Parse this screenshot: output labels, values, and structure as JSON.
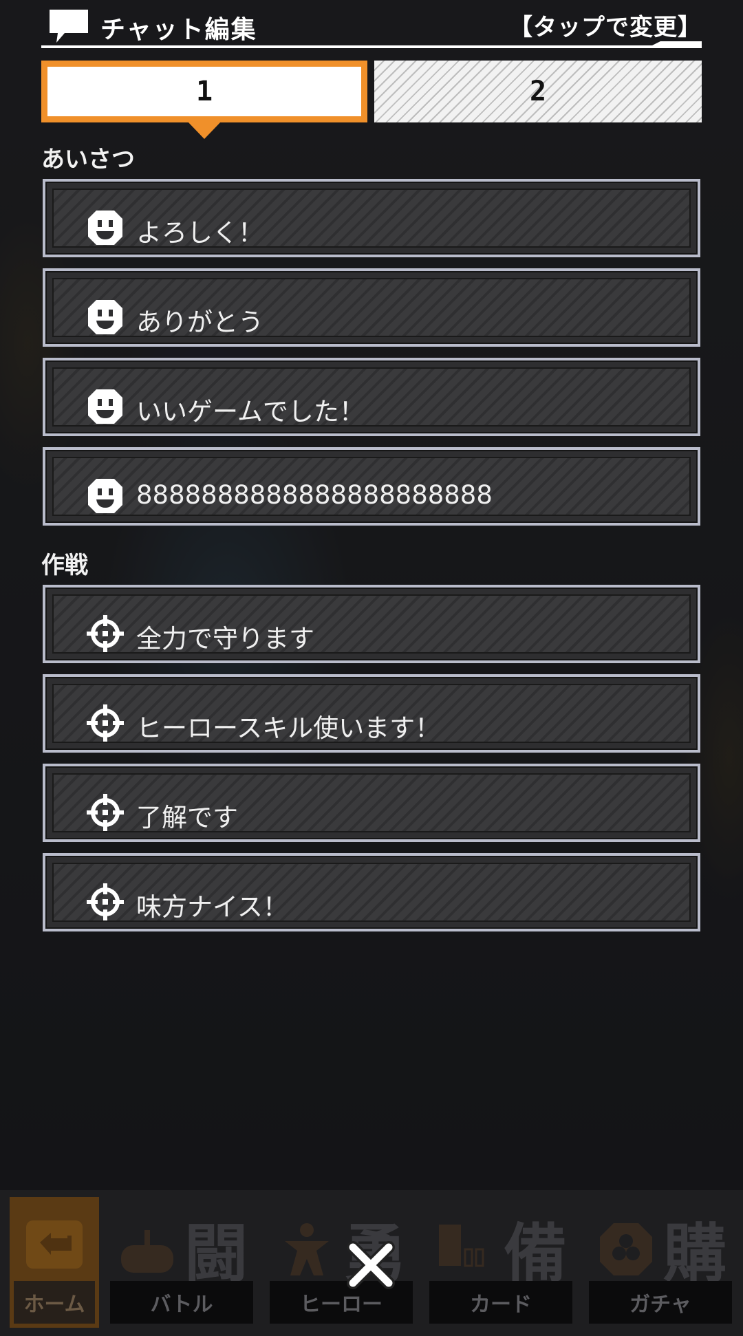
{
  "header": {
    "title": "チャット編集",
    "action": "【タップで変更】",
    "icon": "speech-bubble-icon"
  },
  "tabs": [
    {
      "label": "1",
      "selected": true
    },
    {
      "label": "2",
      "selected": false
    }
  ],
  "sections": [
    {
      "label": "あいさつ",
      "icon": "smiley-face-icon",
      "items": [
        "よろしく！",
        "ありがとう",
        "いいゲームでした！",
        "8888888888888888888888"
      ]
    },
    {
      "label": "作戦",
      "icon": "crosshair-icon",
      "items": [
        "全力で守ります",
        "ヒーロースキル使います！",
        "了解です",
        "味方ナイス！"
      ]
    }
  ],
  "bottom_nav": {
    "items": [
      {
        "label": "ホーム",
        "glyph": "",
        "icon": "return-arrow-icon"
      },
      {
        "label": "バトル",
        "glyph": "闘",
        "icon": "gamepad-icon"
      },
      {
        "label": "ヒーロー",
        "glyph": "勇",
        "icon": "hero-icon"
      },
      {
        "label": "カード",
        "glyph": "備",
        "icon": "card-icon"
      },
      {
        "label": "ガチャ",
        "glyph": "購",
        "icon": "gacha-icon"
      }
    ],
    "close_icon": "close-icon"
  },
  "colors": {
    "accent": "#f0902a",
    "item_border": "#b9bccb",
    "background": "#1c1c1f"
  }
}
